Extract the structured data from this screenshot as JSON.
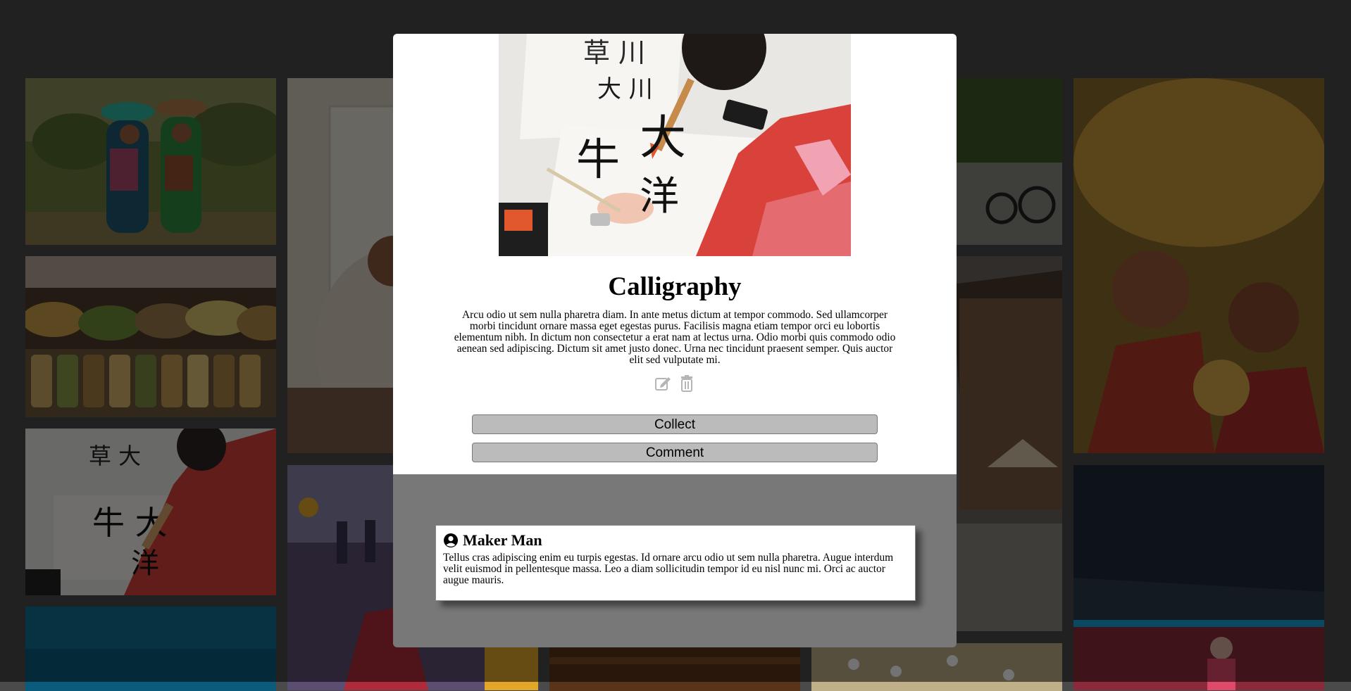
{
  "gallery": {
    "tiles": [
      {
        "name": "gallery-photo-women-baskets"
      },
      {
        "name": "gallery-photo-spice-market"
      },
      {
        "name": "gallery-photo-calligraphy"
      },
      {
        "name": "gallery-photo-blue"
      },
      {
        "name": "gallery-photo-seated-man"
      },
      {
        "name": "gallery-photo-festival-crowd"
      },
      {
        "name": "gallery-photo-alley-plants"
      },
      {
        "name": "gallery-photo-street-bike"
      },
      {
        "name": "gallery-photo-holi-men"
      },
      {
        "name": "gallery-photo-bridge-woman"
      }
    ]
  },
  "post": {
    "title": "Calligraphy",
    "description": "Arcu odio ut sem nulla pharetra diam. In ante metus dictum at tempor commodo. Sed ullamcorper morbi tincidunt ornare massa eget egestas purus. Facilisis magna etiam tempor orci eu lobortis elementum nibh. In dictum non consectetur a erat nam at lectus urna. Odio morbi quis commodo odio aenean sed adipiscing. Dictum sit amet justo donec. Urna nec tincidunt praesent semper. Quis auctor elit sed vulputate mi.",
    "actions": {
      "edit_icon": "edit-icon",
      "delete_icon": "trash-icon"
    },
    "collect_label": "Collect",
    "comment_label": "Comment"
  },
  "comments": [
    {
      "author": "Maker Man",
      "avatar_icon": "user-circle-icon",
      "text": "Tellus cras adipiscing enim eu turpis egestas. Id ornare arcu odio ut sem nulla pharetra. Augue interdum velit euismod in pellentesque massa. Leo a diam sollicitudin tempor id eu nisl nunc mi. Orci ac auctor augue mauris."
    }
  ],
  "colors": {
    "backdrop": "#4a4a4a",
    "modal_lower": "#787878",
    "button_bg": "#bbbbbb"
  }
}
